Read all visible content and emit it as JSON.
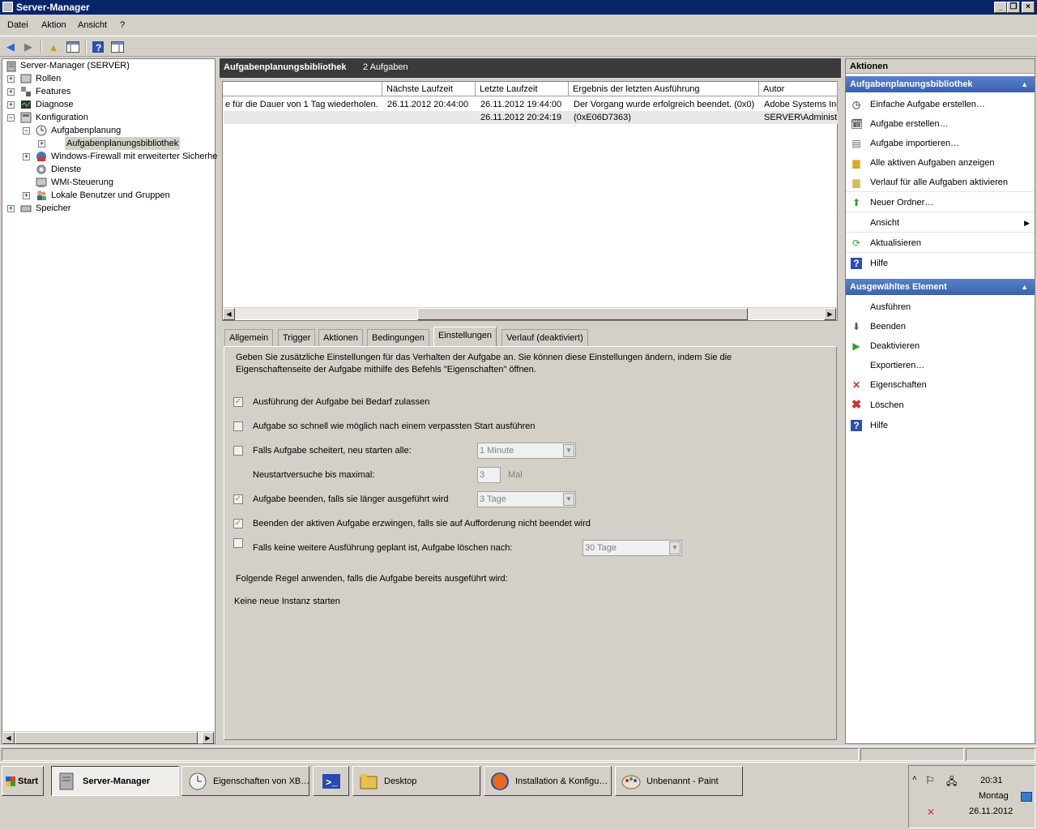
{
  "window": {
    "title": "Server-Manager"
  },
  "menu": [
    "Datei",
    "Aktion",
    "Ansicht",
    "?"
  ],
  "toolbar": {
    "icons": [
      "back-arrow-icon",
      "forward-arrow-icon",
      "up-folder-icon",
      "show-hide-tree-icon",
      "help-icon",
      "show-hide-action-pane-icon"
    ]
  },
  "tree": {
    "root": "Server-Manager (SERVER)",
    "rollen": "Rollen",
    "features": "Features",
    "diagnose": "Diagnose",
    "konfiguration": "Konfiguration",
    "aufgabenplanung": "Aufgabenplanung",
    "bibliothek": "Aufgabenplanungsbibliothek",
    "firewall": "Windows-Firewall mit erweiterter Sicherhe",
    "dienste": "Dienste",
    "wmi": "WMI-Steuerung",
    "benutzer": "Lokale Benutzer und Gruppen",
    "speicher": "Speicher"
  },
  "center": {
    "title": "Aufgabenplanungsbibliothek",
    "count": "2 Aufgaben",
    "columns": [
      "Nächste Laufzeit",
      "Letzte Laufzeit",
      "Ergebnis der letzten Ausführung",
      "Autor"
    ],
    "rows": [
      {
        "trigger": "e für die Dauer von 1 Tag wiederholen.",
        "next": "26.11.2012 20:44:00",
        "last": "26.11.2012 19:44:00",
        "result": "Der Vorgang wurde erfolgreich beendet. (0x0)",
        "author": "Adobe Systems Inc"
      },
      {
        "trigger": "",
        "next": "",
        "last": "26.11.2012 20:24:19",
        "result": "(0xE06D7363)",
        "author": "SERVER\\Administra"
      }
    ]
  },
  "tabs": [
    "Allgemein",
    "Trigger",
    "Aktionen",
    "Bedingungen",
    "Einstellungen",
    "Verlauf (deaktiviert)"
  ],
  "settings": {
    "intro_line1": "Geben Sie zusätzliche Einstellungen für das Verhalten der Aufgabe an. Sie können diese Einstellungen ändern, indem Sie die",
    "intro_line2": "Eigenschaftenseite der Aufgabe mithilfe des Befehls \"Eigenschaften\" öffnen.",
    "opt1": "Ausführung der Aufgabe bei Bedarf zulassen",
    "opt2": "Aufgabe so schnell wie möglich nach einem verpassten Start ausführen",
    "opt3": "Falls Aufgabe scheitert, neu starten alle:",
    "opt3_value": "1 Minute",
    "retry_label": "Neustartversuche bis maximal:",
    "retry_value": "3",
    "retry_unit": "Mal",
    "opt4": "Aufgabe beenden, falls sie länger ausgeführt wird",
    "opt4_value": "3 Tage",
    "opt5": "Beenden der aktiven Aufgabe erzwingen, falls sie auf Aufforderung nicht beendet wird",
    "opt6": "Falls keine weitere Ausführung geplant ist, Aufgabe löschen nach:",
    "opt6_value": "30 Tage",
    "rule_label": "Folgende Regel anwenden, falls die Aufgabe bereits ausgeführt wird:",
    "rule_value": "Keine neue Instanz starten",
    "checked": [
      true,
      false,
      false,
      true,
      true,
      false
    ]
  },
  "actions": {
    "title": "Aktionen",
    "section1": "Aufgabenplanungsbibliothek",
    "items1": [
      "Einfache Aufgabe erstellen…",
      "Aufgabe erstellen…",
      "Aufgabe importieren…",
      "Alle aktiven Aufgaben anzeigen",
      "Verlauf für alle Aufgaben aktivieren",
      "Neuer Ordner…",
      "Ansicht",
      "Aktualisieren",
      "Hilfe"
    ],
    "section2": "Ausgewähltes Element",
    "items2": [
      "Ausführen",
      "Beenden",
      "Deaktivieren",
      "Exportieren…",
      "Eigenschaften",
      "Löschen",
      "Hilfe"
    ]
  },
  "taskbar": {
    "start": "Start",
    "buttons": [
      "Server-Manager",
      "Eigenschaften von XB…",
      "",
      "Desktop",
      "Installation & Konfigu…",
      "Unbenannt - Paint"
    ],
    "clock_time": "20:31",
    "clock_day": "Montag",
    "clock_date": "26.11.2012"
  },
  "colors": {
    "title_bar": "#0a246a",
    "action_header": "#3a62b0",
    "center_header": "#3a3a3a"
  }
}
